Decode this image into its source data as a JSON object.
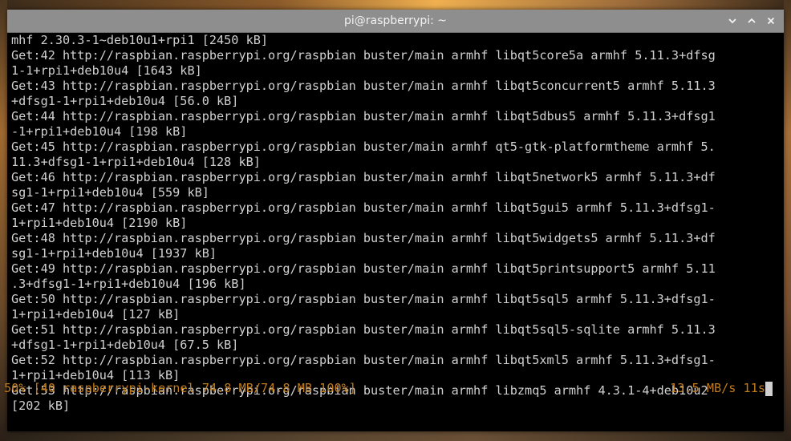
{
  "window": {
    "title": "pi@raspberrypi: ~",
    "controls": {
      "minimize_icon": "chevron-down-icon",
      "maximize_icon": "chevron-up-icon",
      "close_icon": "close-icon"
    }
  },
  "terminal": {
    "text_color": "#d0d0d0",
    "status_color": "#c07a18",
    "lines": [
      "mhf 2.30.3-1~deb10u1+rpi1 [2450 kB]",
      "Get:42 http://raspbian.raspberrypi.org/raspbian buster/main armhf libqt5core5a armhf 5.11.3+dfsg",
      "1-1+rpi1+deb10u4 [1643 kB]",
      "Get:43 http://raspbian.raspberrypi.org/raspbian buster/main armhf libqt5concurrent5 armhf 5.11.3",
      "+dfsg1-1+rpi1+deb10u4 [56.0 kB]",
      "Get:44 http://raspbian.raspberrypi.org/raspbian buster/main armhf libqt5dbus5 armhf 5.11.3+dfsg1",
      "-1+rpi1+deb10u4 [198 kB]",
      "Get:45 http://raspbian.raspberrypi.org/raspbian buster/main armhf qt5-gtk-platformtheme armhf 5.",
      "11.3+dfsg1-1+rpi1+deb10u4 [128 kB]",
      "Get:46 http://raspbian.raspberrypi.org/raspbian buster/main armhf libqt5network5 armhf 5.11.3+df",
      "sg1-1+rpi1+deb10u4 [559 kB]",
      "Get:47 http://raspbian.raspberrypi.org/raspbian buster/main armhf libqt5gui5 armhf 5.11.3+dfsg1-",
      "1+rpi1+deb10u4 [2190 kB]",
      "Get:48 http://raspbian.raspberrypi.org/raspbian buster/main armhf libqt5widgets5 armhf 5.11.3+df",
      "sg1-1+rpi1+deb10u4 [1937 kB]",
      "Get:49 http://raspbian.raspberrypi.org/raspbian buster/main armhf libqt5printsupport5 armhf 5.11",
      ".3+dfsg1-1+rpi1+deb10u4 [196 kB]",
      "Get:50 http://raspbian.raspberrypi.org/raspbian buster/main armhf libqt5sql5 armhf 5.11.3+dfsg1-",
      "1+rpi1+deb10u4 [127 kB]",
      "Get:51 http://raspbian.raspberrypi.org/raspbian buster/main armhf libqt5sql5-sqlite armhf 5.11.3",
      "+dfsg1-1+rpi1+deb10u4 [67.5 kB]",
      "Get:52 http://raspbian.raspberrypi.org/raspbian buster/main armhf libqt5xml5 armhf 5.11.3+dfsg1-",
      "1+rpi1+deb10u4 [113 kB]",
      "Get:53 http://raspbian.raspberrypi.org/raspbian buster/main armhf libzmq5 armhf 4.3.1-4+deb10u2",
      "[202 kB]"
    ],
    "status": {
      "left": "50% [40 raspberrypi-kernel 74.8 MB/74.8 MB 100%]",
      "right": "13.5 MB/s 11s"
    }
  }
}
